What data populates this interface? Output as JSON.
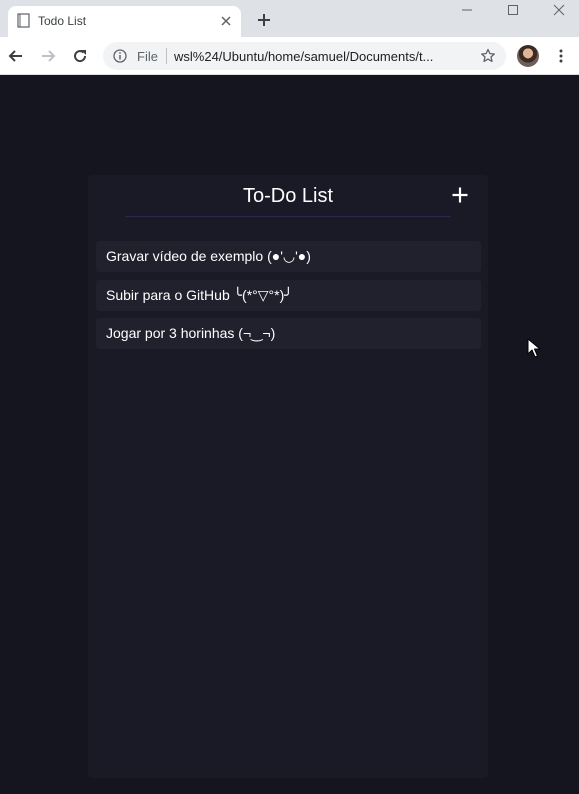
{
  "browser": {
    "tab_title": "Todo List",
    "omnibox": {
      "scheme_label": "File",
      "url": "wsl%24/Ubuntu/home/samuel/Documents/t..."
    }
  },
  "app": {
    "title": "To-Do List",
    "todos": [
      {
        "text": "Gravar vídeo de exemplo (●'◡'●)"
      },
      {
        "text": "Subir para o GitHub ╰(*°▽°*)╯"
      },
      {
        "text": "Jogar por 3 horinhas (¬‿¬)"
      }
    ]
  },
  "colors": {
    "page_bg": "#14151f",
    "panel_bg": "#1a1a27",
    "item_bg": "#21212e",
    "divider": "#2b2850"
  }
}
